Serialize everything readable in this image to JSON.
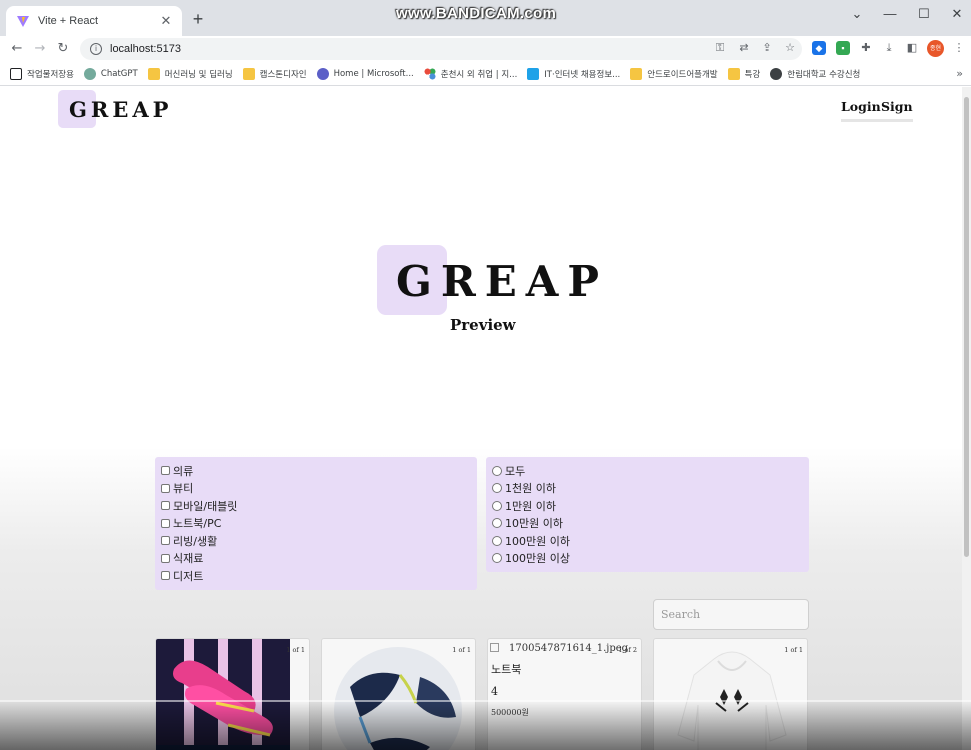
{
  "browser": {
    "tab_title": "Vite + React",
    "url": "localhost:5173",
    "watermark": "www.BANDICAM.com",
    "profile_label": "종현",
    "bookmarks": [
      {
        "label": "작업물저장용",
        "icon_color": "#202124"
      },
      {
        "label": "ChatGPT",
        "icon_color": "#74aa9c"
      },
      {
        "label": "머신러닝 및 딥러닝",
        "icon_color": "#f5c542"
      },
      {
        "label": "캡스톤디자인",
        "icon_color": "#f5c542"
      },
      {
        "label": "Home | Microsoft...",
        "icon_color": "#5b5fc7"
      },
      {
        "label": "춘천시 외 취업 | 지...",
        "icon_color": "#4a90d9"
      },
      {
        "label": "IT·인터넷 채용정보...",
        "icon_color": "#1fa2e8"
      },
      {
        "label": "안드로이드어플개발",
        "icon_color": "#f5c542"
      },
      {
        "label": "특강",
        "icon_color": "#f5c542"
      },
      {
        "label": "한림대학교 수강신청",
        "icon_color": "#3c4043"
      }
    ]
  },
  "header": {
    "logo": "GREAP",
    "login_label": "Login",
    "sign_label": "Sign"
  },
  "hero": {
    "title": "GREAP",
    "subtitle": "Preview"
  },
  "filters": {
    "categories": [
      "의류",
      "뷰티",
      "모바일/태블릿",
      "노트북/PC",
      "리빙/생활",
      "식재료",
      "디저트"
    ],
    "prices": [
      "모두",
      "1천원 이하",
      "1만원 이하",
      "10만원 이하",
      "100만원 이하",
      "100만원 이상"
    ]
  },
  "search": {
    "placeholder": "Search"
  },
  "products": [
    {
      "count": "1 of 1",
      "image": "pink soccer cleats"
    },
    {
      "count": "1 of 1",
      "image": "soccer ball"
    },
    {
      "count": "1 of 2",
      "image_alt": "1700547871614_1.jpeg",
      "name": "노트북",
      "quantity": "4",
      "price": "500000원"
    },
    {
      "count": "1 of 1",
      "image": "white hoodie"
    }
  ],
  "colors": {
    "accent_lavender": "#e8dcf7",
    "tabstrip": "#dee1e6"
  }
}
